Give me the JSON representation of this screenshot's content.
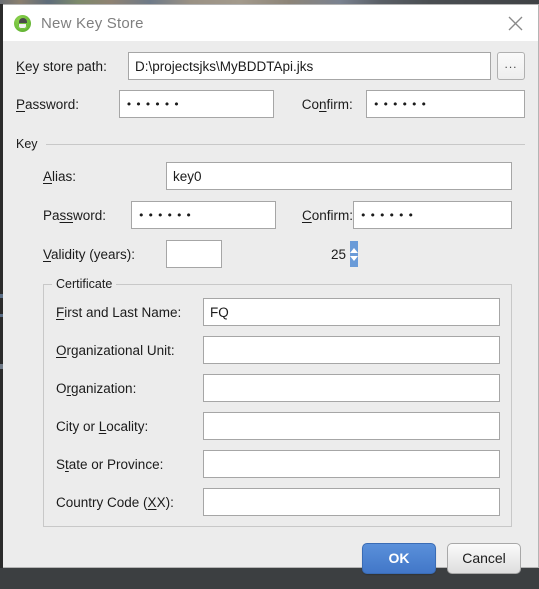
{
  "window": {
    "title": "New Key Store",
    "app_icon": "android-studio-icon",
    "close_icon": "close-icon"
  },
  "keystore": {
    "path_label_pre": "K",
    "path_label_post": "ey store path:",
    "path_value": "D:\\projectsjks\\MyBDDTApi.jks",
    "browse_label": "...",
    "password_label_pre": "P",
    "password_label_post": "assword:",
    "password_value": "••••••",
    "confirm_label_pre": "Co",
    "confirm_label_mid": "n",
    "confirm_label_post": "firm:",
    "confirm_value": "••••••"
  },
  "key_group": {
    "title": "Key",
    "alias_label_pre": "",
    "alias_label_mid": "A",
    "alias_label_post": "lias:",
    "alias_value": "key0",
    "password_label_pre": "Pa",
    "password_label_mid": "ss",
    "password_label_post": "word:",
    "password_value": "••••••",
    "confirm_label_pre": "",
    "confirm_label_mid": "C",
    "confirm_label_post": "onfirm:",
    "confirm_value": "••••••",
    "validity_label_pre": "",
    "validity_label_mid": "V",
    "validity_label_post": "alidity (years):",
    "validity_value": "25",
    "spinner_up_icon": "chevron-up-icon",
    "spinner_down_icon": "chevron-down-icon"
  },
  "certificate": {
    "title": "Certificate",
    "fields": [
      {
        "name": "first-and-last-name",
        "label_pre": "",
        "label_mid": "F",
        "label_post": "irst and Last Name:",
        "value": "FQ"
      },
      {
        "name": "organizational-unit",
        "label_pre": "",
        "label_mid": "O",
        "label_post": "rganizational Unit:",
        "value": ""
      },
      {
        "name": "organization",
        "label_pre": "O",
        "label_mid": "r",
        "label_post": "ganization:",
        "value": ""
      },
      {
        "name": "city-or-locality",
        "label_pre": "City or ",
        "label_mid": "L",
        "label_post": "ocality:",
        "value": ""
      },
      {
        "name": "state-or-province",
        "label_pre": "S",
        "label_mid": "t",
        "label_post": "ate or Province:",
        "value": ""
      },
      {
        "name": "country-code",
        "label_pre": "Country Code (",
        "label_mid": "X",
        "label_post": "X):",
        "value": ""
      }
    ]
  },
  "footer": {
    "ok_label": "OK",
    "cancel_label": "Cancel"
  },
  "colors": {
    "accent_blue": "#4277c8",
    "spinner_blue": "#6a9bd8",
    "dialog_bg": "#ececec",
    "titlebar_bg": "#ffffff",
    "icon_green": "#6fbf3b"
  }
}
